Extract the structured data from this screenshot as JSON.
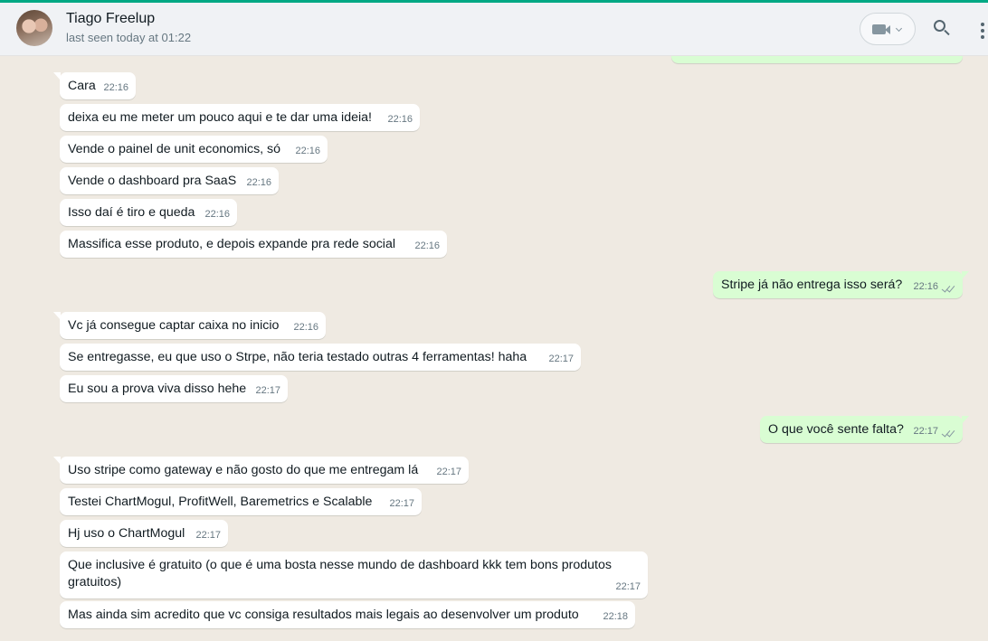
{
  "header": {
    "contact_name": "Tiago Freelup",
    "status": "last seen today at 01:22",
    "icons": [
      "video-call-icon",
      "search-icon",
      "menu-icon"
    ]
  },
  "colors": {
    "accent": "#00a884",
    "incoming_bubble": "#ffffff",
    "outgoing_bubble": "#d9fdd3",
    "chat_bg": "#efeae2"
  },
  "messages": [
    {
      "dir": "in",
      "text": "Cara",
      "time": "22:16"
    },
    {
      "dir": "in",
      "text": "deixa eu me meter um pouco aqui e te dar uma ideia!",
      "time": "22:16"
    },
    {
      "dir": "in",
      "text": "Vende o painel de unit economics, só",
      "time": "22:16"
    },
    {
      "dir": "in",
      "text": "Vende o dashboard pra SaaS",
      "time": "22:16"
    },
    {
      "dir": "in",
      "text": "Isso daí é tiro e queda",
      "time": "22:16"
    },
    {
      "dir": "in",
      "text": "Massifica esse produto, e depois expande pra rede social",
      "time": "22:16"
    },
    {
      "dir": "out",
      "text": "Stripe já não entrega isso será?",
      "time": "22:16"
    },
    {
      "dir": "in",
      "text": "Vc já consegue captar caixa no inicio",
      "time": "22:16"
    },
    {
      "dir": "in",
      "text": "Se entregasse, eu que uso o Strpe, não teria testado outras 4 ferramentas! haha",
      "time": "22:17"
    },
    {
      "dir": "in",
      "text": "Eu sou a prova viva disso hehe",
      "time": "22:17"
    },
    {
      "dir": "out",
      "text": "O que você sente falta?",
      "time": "22:17"
    },
    {
      "dir": "in",
      "text": "Uso stripe como gateway e não gosto do que me entregam lá",
      "time": "22:17"
    },
    {
      "dir": "in",
      "text": "Testei ChartMogul, ProfitWell, Baremetrics e Scalable",
      "time": "22:17"
    },
    {
      "dir": "in",
      "text": "Hj uso o ChartMogul",
      "time": "22:17"
    },
    {
      "dir": "in",
      "text": "Que inclusive é gratuito (o que é uma bosta nesse mundo de dashboard kkk tem bons produtos gratuitos)",
      "time": "22:17"
    },
    {
      "dir": "in",
      "text": "Mas ainda sim acredito que vc consiga resultados mais legais ao desenvolver um produto",
      "time": "22:18"
    }
  ]
}
